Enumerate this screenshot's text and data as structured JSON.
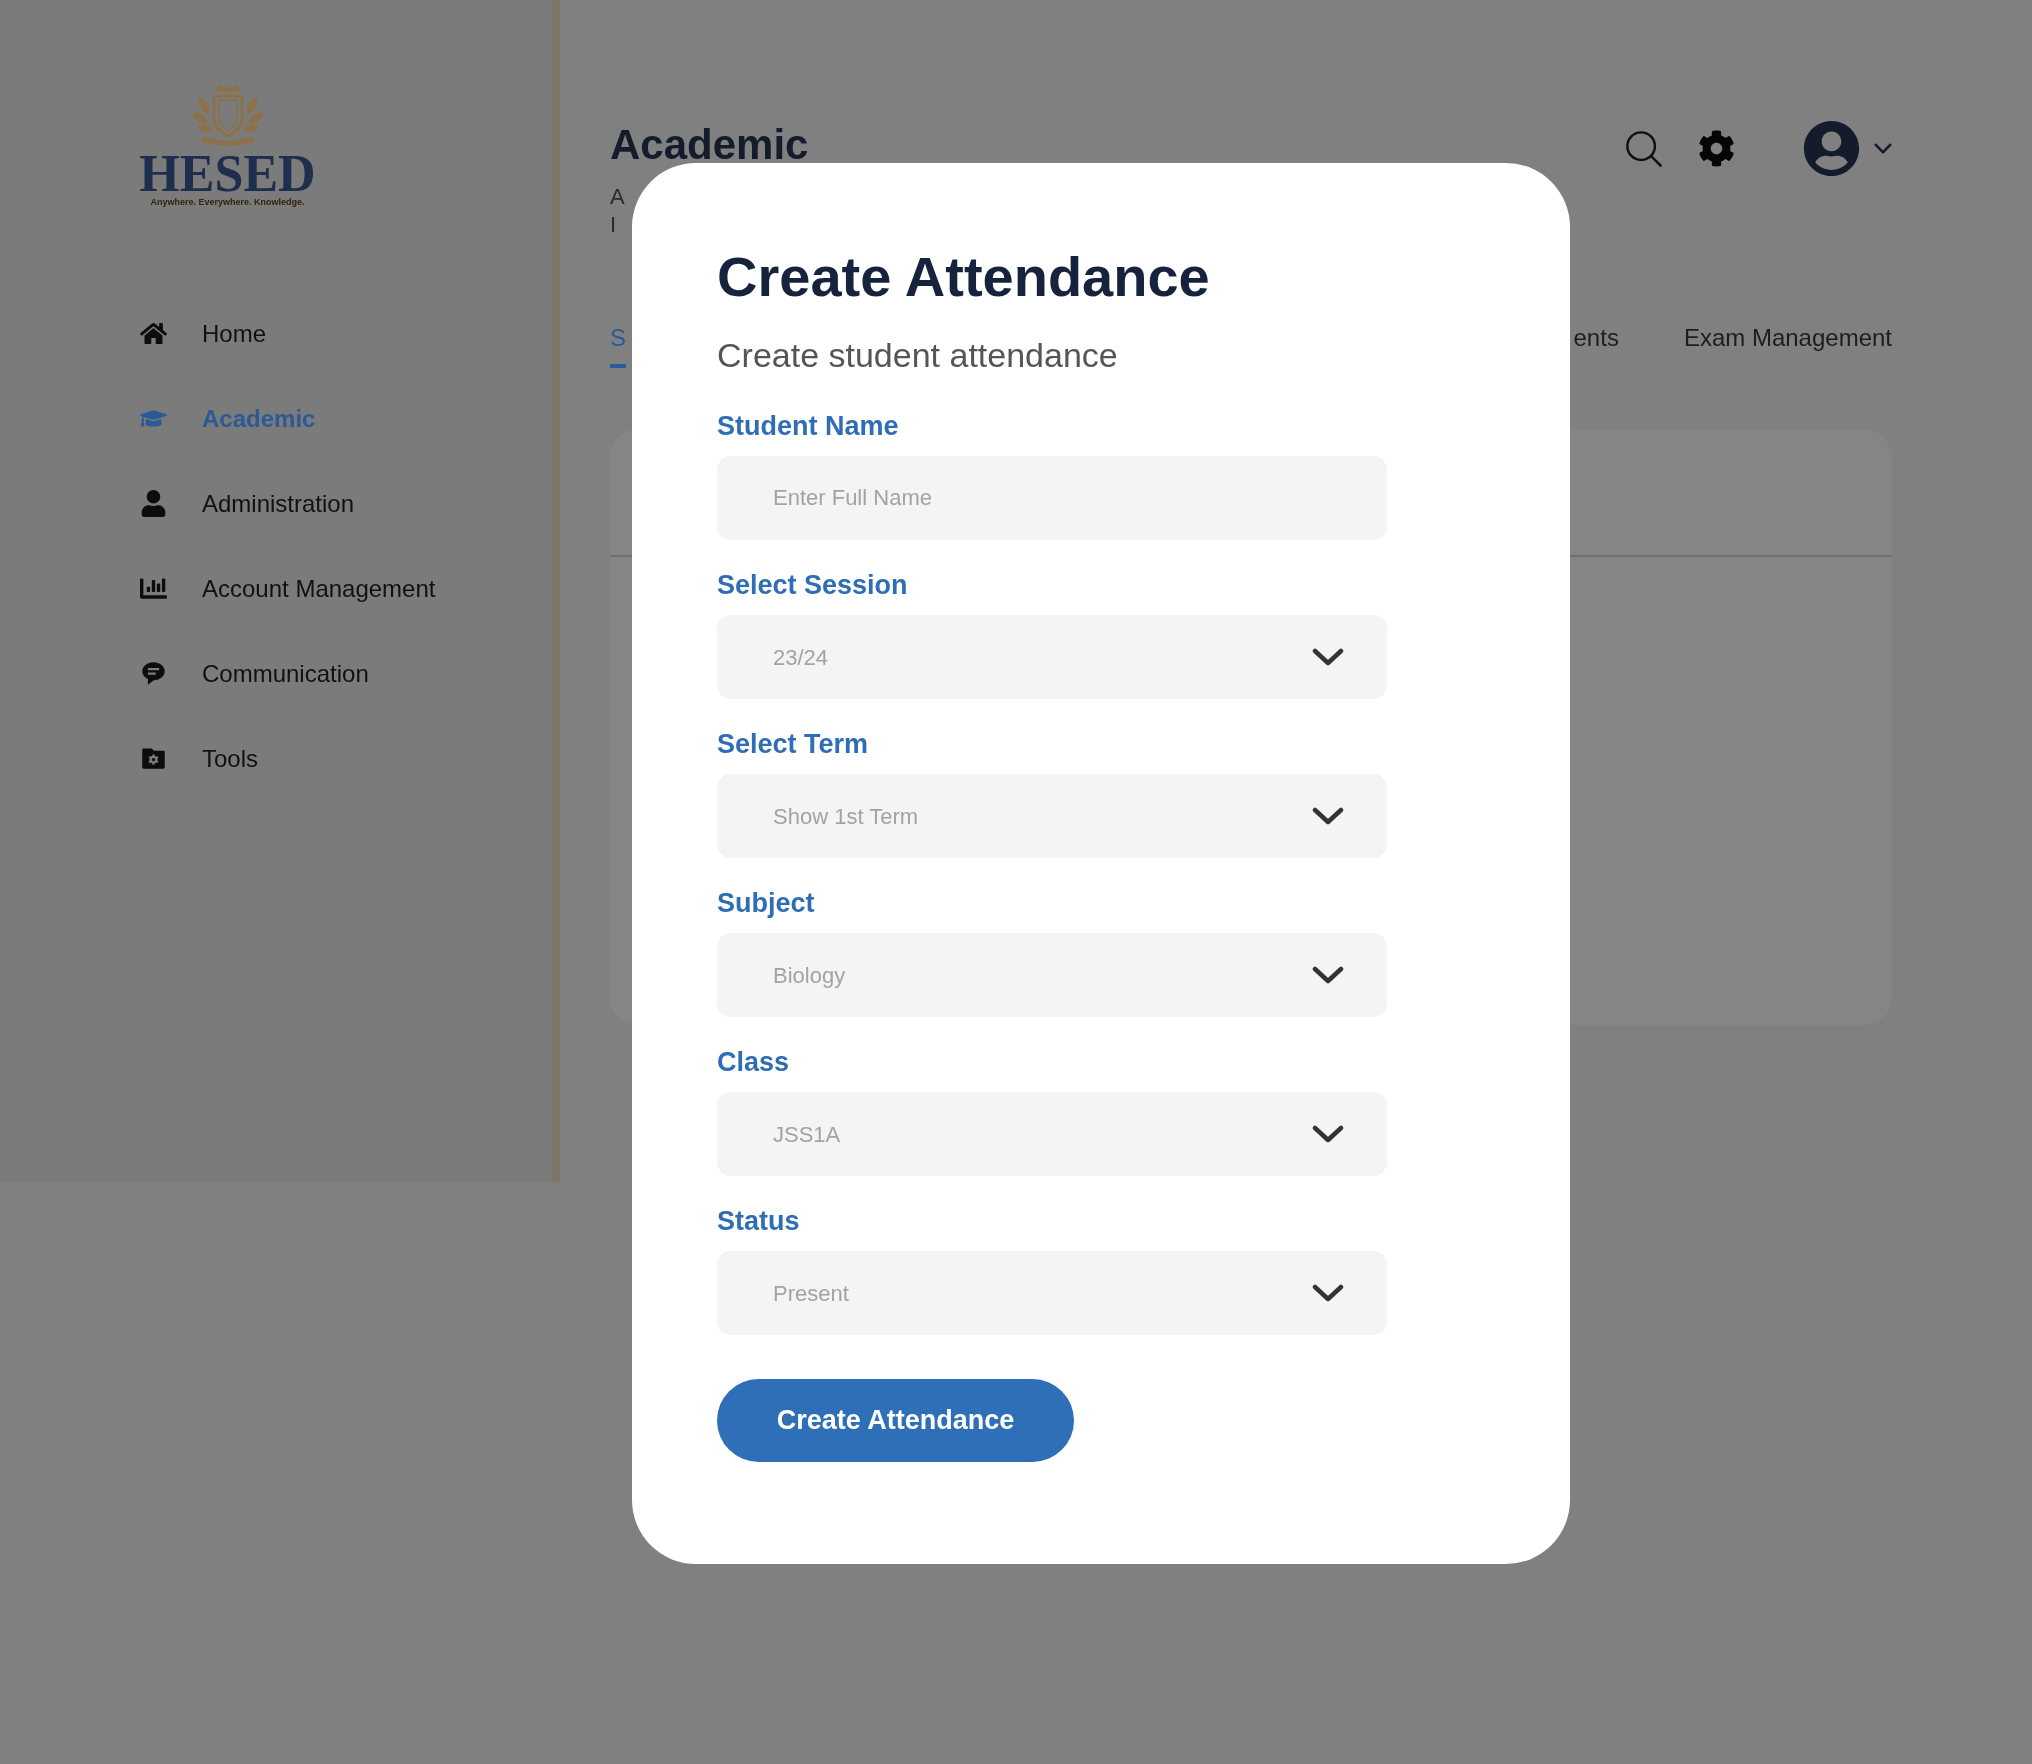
{
  "sidebar": {
    "logo": {
      "name": "HESED",
      "tagline": "Anywhere. Everywhere. Knowledge."
    },
    "items": [
      {
        "label": "Home",
        "selected": false
      },
      {
        "label": "Academic",
        "selected": true
      },
      {
        "label": "Administration",
        "selected": false
      },
      {
        "label": "Account Management",
        "selected": false
      },
      {
        "label": "Communication",
        "selected": false
      },
      {
        "label": "Tools",
        "selected": false
      }
    ]
  },
  "header": {
    "title": "Academic",
    "description_lines": [
      "A",
      "I"
    ]
  },
  "tabs": [
    {
      "label": "S",
      "selected": true
    },
    {
      "label": "ents",
      "selected": false
    },
    {
      "label": "Exam Management",
      "selected": false
    }
  ],
  "modal": {
    "title": "Create Attendance",
    "subtitle": "Create student attendance",
    "fields": [
      {
        "kind": "text",
        "label": "Student Name",
        "placeholder": "Enter Full Name"
      },
      {
        "kind": "select",
        "label": "Select Session",
        "value": "23/24"
      },
      {
        "kind": "select",
        "label": "Select Term",
        "value": "Show 1st Term"
      },
      {
        "kind": "select",
        "label": "Subject",
        "value": "Biology"
      },
      {
        "kind": "select",
        "label": "Class",
        "value": "JSS1A"
      },
      {
        "kind": "select",
        "label": "Status",
        "value": "Present"
      }
    ],
    "submit": "Create Attendance"
  }
}
